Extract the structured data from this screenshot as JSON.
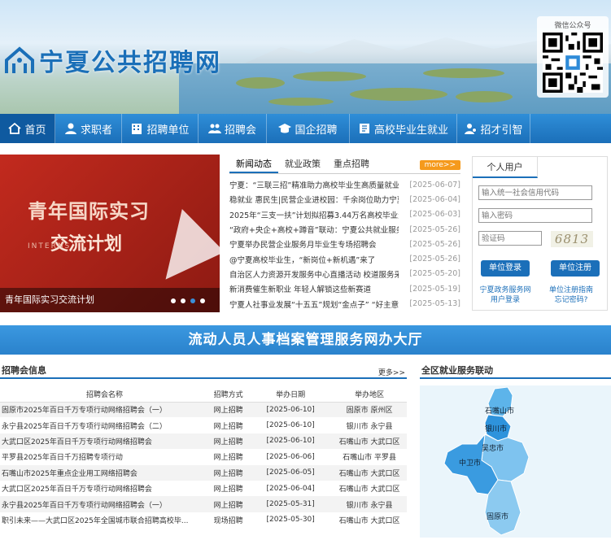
{
  "site": {
    "title": "宁夏公共招聘网",
    "qr_label": "微信公众号"
  },
  "nav": [
    {
      "label": "首页",
      "icon": "home-icon"
    },
    {
      "label": "求职者",
      "icon": "user-icon"
    },
    {
      "label": "招聘单位",
      "icon": "building-icon"
    },
    {
      "label": "招聘会",
      "icon": "group-icon"
    },
    {
      "label": "国企招聘",
      "icon": "graduation-icon"
    },
    {
      "label": "高校毕业生就业",
      "icon": "book-icon"
    },
    {
      "label": "招才引智",
      "icon": "person-badge-icon"
    }
  ],
  "banner": {
    "caption": "青年国际实习交流计划",
    "line1": "青年国际实习",
    "line2": "交流计划",
    "sub": "INTERNS"
  },
  "news": {
    "tabs": [
      "新闻动态",
      "就业政策",
      "重点招聘"
    ],
    "more": "more>>",
    "items": [
      {
        "title": "宁夏：“三联三招”精准助力高校毕业生高质量就业",
        "date": "[2025-06-07]"
      },
      {
        "title": "稳就业 惠民生|民营企业进校园：千余岗位助力宁夏",
        "date": "[2025-06-04]"
      },
      {
        "title": "2025年“三支一扶”计划拟招募3.44万名高校毕业生",
        "date": "[2025-06-03]"
      },
      {
        "title": "“政府+央企+高校+蹲音”联动：宁夏公共就业服务进",
        "date": "[2025-05-26]"
      },
      {
        "title": "宁夏举办民营企业服务月毕业生专场招聘会",
        "date": "[2025-05-26]"
      },
      {
        "title": "@宁夏高校毕业生，“新岗位+新机遇”来了",
        "date": "[2025-05-26]"
      },
      {
        "title": "自治区人力资源开发服务中心直播活动 校道服务采购",
        "date": "[2025-05-20]"
      },
      {
        "title": "新消费催生新职业 年轻人解锁这些新赛道",
        "date": "[2025-05-19]"
      },
      {
        "title": "宁夏人社事业发展“十五五”规划“金点子” “好主意",
        "date": "[2025-05-13]"
      }
    ]
  },
  "login": {
    "tab": "个人用户",
    "code_placeholder": "输入统一社会信用代码",
    "pwd_placeholder": "输入密码",
    "captcha_placeholder": "验证码",
    "captcha_value": "6813",
    "login_btn": "单位登录",
    "register_btn": "单位注册",
    "link1a": "宁夏政务服务网",
    "link1b": "用户登录",
    "link2a": "单位注册指南",
    "link2b": "忘记密码?"
  },
  "bigbar": "流动人员人事档案管理服务网办大厅",
  "fairs": {
    "title": "招聘会信息",
    "more": "更多>>",
    "headers": [
      "招聘会名称",
      "招聘方式",
      "举办日期",
      "举办地区"
    ],
    "rows": [
      [
        "固原市2025年百日千万专项行动网络招聘会（一）",
        "网上招聘",
        "[2025-06-10]",
        "固原市 原州区"
      ],
      [
        "永宁县2025年百日千万专项行动网络招聘会（二）",
        "网上招聘",
        "[2025-06-10]",
        "银川市 永宁县"
      ],
      [
        "大武口区2025年百日千万专项行动网络招聘会",
        "网上招聘",
        "[2025-06-10]",
        "石嘴山市 大武口区"
      ],
      [
        "平罗县2025年百日千万招聘专项行动",
        "网上招聘",
        "[2025-06-06]",
        "石嘴山市 平罗县"
      ],
      [
        "石嘴山市2025年重点企业用工网络招聘会",
        "网上招聘",
        "[2025-06-05]",
        "石嘴山市 大武口区"
      ],
      [
        "大武口区2025年百日千万专项行动网络招聘会",
        "网上招聘",
        "[2025-06-04]",
        "石嘴山市 大武口区"
      ],
      [
        "永宁县2025年百日千万专项行动网络招聘会（一）",
        "网上招聘",
        "[2025-05-31]",
        "银川市 永宁县"
      ],
      [
        "职引未来——大武口区2025年全国城市联合招聘高校毕...",
        "现场招聘",
        "[2025-05-30]",
        "石嘴山市 大武口区"
      ]
    ]
  },
  "region": {
    "title": "全区就业服务联动",
    "cities": [
      "石嘴山市",
      "银川市",
      "吴忠市",
      "中卫市",
      "固原市"
    ],
    "colors": {
      "shizuishan": "#5db4ea",
      "yinchuan": "#2e93dc",
      "wuzhong": "#7ec3ef",
      "zhongwei": "#3a9be0",
      "guyuan": "#8ccaf0"
    }
  }
}
